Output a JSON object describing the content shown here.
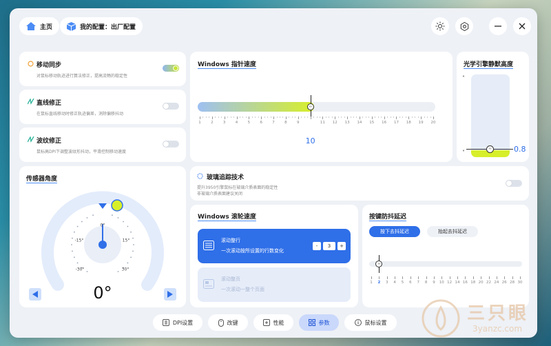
{
  "header": {
    "home_label": "主页",
    "config_label": "我的配置：出厂配置"
  },
  "motion_sync": {
    "title": "移动同步",
    "desc": "对鼠标移动轨迹进行算法修正，提高流畅的稳定性",
    "enabled": true
  },
  "angle_snap": {
    "title": "直线修正",
    "desc": "在鼠标直线移动时修正轨迹偏差，消除偏移抖动",
    "enabled": false
  },
  "ripple": {
    "title": "波纹修正",
    "desc": "鼠标高DPI下调整波纹形抖动，平滑控制移动速度",
    "enabled": false
  },
  "pointer_speed": {
    "title": "Windows 指针速度",
    "value": "10",
    "min": 1,
    "max": 20,
    "ticks": [
      "1",
      "2",
      "3",
      "4",
      "5",
      "6",
      "7",
      "8",
      "9",
      "10",
      "11",
      "12",
      "13",
      "14",
      "15",
      "16",
      "17",
      "18",
      "19",
      "20"
    ]
  },
  "lod": {
    "title": "光学引擎静默高度",
    "value": "0.8"
  },
  "glass": {
    "title": "玻璃追踪技术",
    "desc1": "提升3950引擎鼠标在玻璃介质表面的稳定性",
    "desc2": "非玻璃介质表面建议关闭",
    "enabled": false
  },
  "sensor_angle": {
    "title": "传感器角度",
    "value": "0°",
    "labels": {
      "center": "0°",
      "l15": "-15°",
      "r15": "15°",
      "l30": "-30°",
      "r30": "30°"
    }
  },
  "scroll": {
    "title": "Windows 滚轮速度",
    "line_title": "滚动整行",
    "line_desc": "一次滚动按所设置的行数变化",
    "minus": "-",
    "plus": "+",
    "lines": "3",
    "page_title": "滚动整页",
    "page_desc": "一次滚动一整个页面"
  },
  "debounce": {
    "title": "按键防抖延迟",
    "tab_press": "按下去抖延迟",
    "tab_release": "抬起去抖延迟",
    "value": 2,
    "ticks": [
      "1",
      "2",
      "3",
      "4",
      "5",
      "6",
      "7",
      "8",
      "9",
      "10",
      "12",
      "14",
      "16",
      "18",
      "20",
      "22",
      "24",
      "26",
      "28",
      "30"
    ]
  },
  "bottom_tabs": [
    {
      "label": "DPI设置",
      "icon": "dpi-icon"
    },
    {
      "label": "改键",
      "icon": "mouse-icon"
    },
    {
      "label": "性能",
      "icon": "performance-icon"
    },
    {
      "label": "参数",
      "icon": "grid-icon"
    },
    {
      "label": "鼠标设置",
      "icon": "info-icon"
    }
  ],
  "watermark": {
    "brand": "三只眼",
    "url": "3yanzc.com"
  },
  "colors": {
    "accent": "#2f6fe8",
    "lime": "#c8e63a",
    "blue_light": "#8fb6f0"
  }
}
